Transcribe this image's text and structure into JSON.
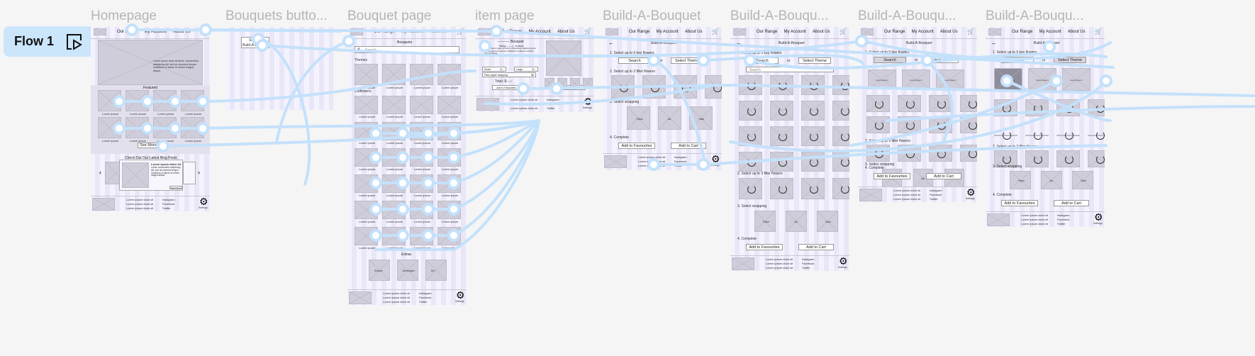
{
  "flow": {
    "label": "Flow 1",
    "icon": "play-frame-icon"
  },
  "frames": [
    "Homepage",
    "Bouquets butto...",
    "Bouquet page",
    "item page",
    "Build-A-Bouquet",
    "Build-A-Bouqu...",
    "Build-A-Bouqu...",
    "Build-A-Bouqu..."
  ],
  "nav": {
    "our_range": "Our Range",
    "my_account": "My Account",
    "about_us": "About Us",
    "cart": "My Cart"
  },
  "footer": {
    "lines": [
      "Lorem ipsum dolor sit",
      "Lorem ipsum dolor sit",
      "Lorem ipsum dolor sit"
    ],
    "social": [
      "Instagram",
      "Facebook",
      "Twitter"
    ],
    "settings": "Settings"
  },
  "homepage": {
    "hero_text": "Lorem ipsum dolor sit amet, consectetur adipiscing elit, sed do eiusmod tempor incididunt ut labore et dolore magna aliqua.",
    "featured": "Featured",
    "item_label": "Lorem ipsum",
    "see_more": "See More",
    "blog_title": "Check Out Our Latest Blog Posts",
    "blog_heading": "Lorem ipsum dolor sit",
    "blog_text": "Lorem consectetur adipiscing elit, sed do eiusmod tempor incididunt ut labore et dolore magna aliqua.",
    "read_more": "Read More"
  },
  "bouquets_button": {
    "search": "Search",
    "build": "Build-A-Bouquet"
  },
  "bouquet_page": {
    "title": "Bouquets",
    "search_placeholder": "Search",
    "themes": "Themes",
    "cut_flowers": "Cutflowers",
    "item_label": "Lorem ipsum",
    "extras": "Extras",
    "extras_items": [
      "Snacks",
      "Beverages",
      "Etc"
    ]
  },
  "item_page": {
    "title": "---------- Bouquet",
    "rating": "Rating ------- (-- reviews)",
    "desc": "Lorem ipsum dolor sit amet, consectetur adipiscing elit, sed do eiusmod tempor incididunt ut labore et dolore magna aliqua.",
    "size_small": "Small",
    "size_large": "Large",
    "price": "$---",
    "wrap": "Plain paper wrapping",
    "wrap_price": "$5",
    "total": "Total: $--.--",
    "fav": "Add to Favourites",
    "cart": "Add to Cart"
  },
  "bab": {
    "title": "Build-A-Bouquet",
    "step1": "1. Select up to 5 key flowers",
    "search": "Search",
    "or": "or",
    "theme": "Select Theme",
    "search_placeholder": "Search",
    "theme_label": "Lorem Ipsum",
    "step2": "2. Select up to 3 filler flowers",
    "step3": "3. Select wrapping",
    "wraps": [
      "Paper",
      "Jar",
      "Vase"
    ],
    "step4": "4. Complete",
    "fav": "Add to Favourites",
    "cart": "Add to Cart"
  },
  "colors": {
    "flow_badge": "#cbe5fb",
    "connector": "#c4e1fb",
    "frame": "#f4f3fd",
    "canvas": "#f5f5f5"
  }
}
